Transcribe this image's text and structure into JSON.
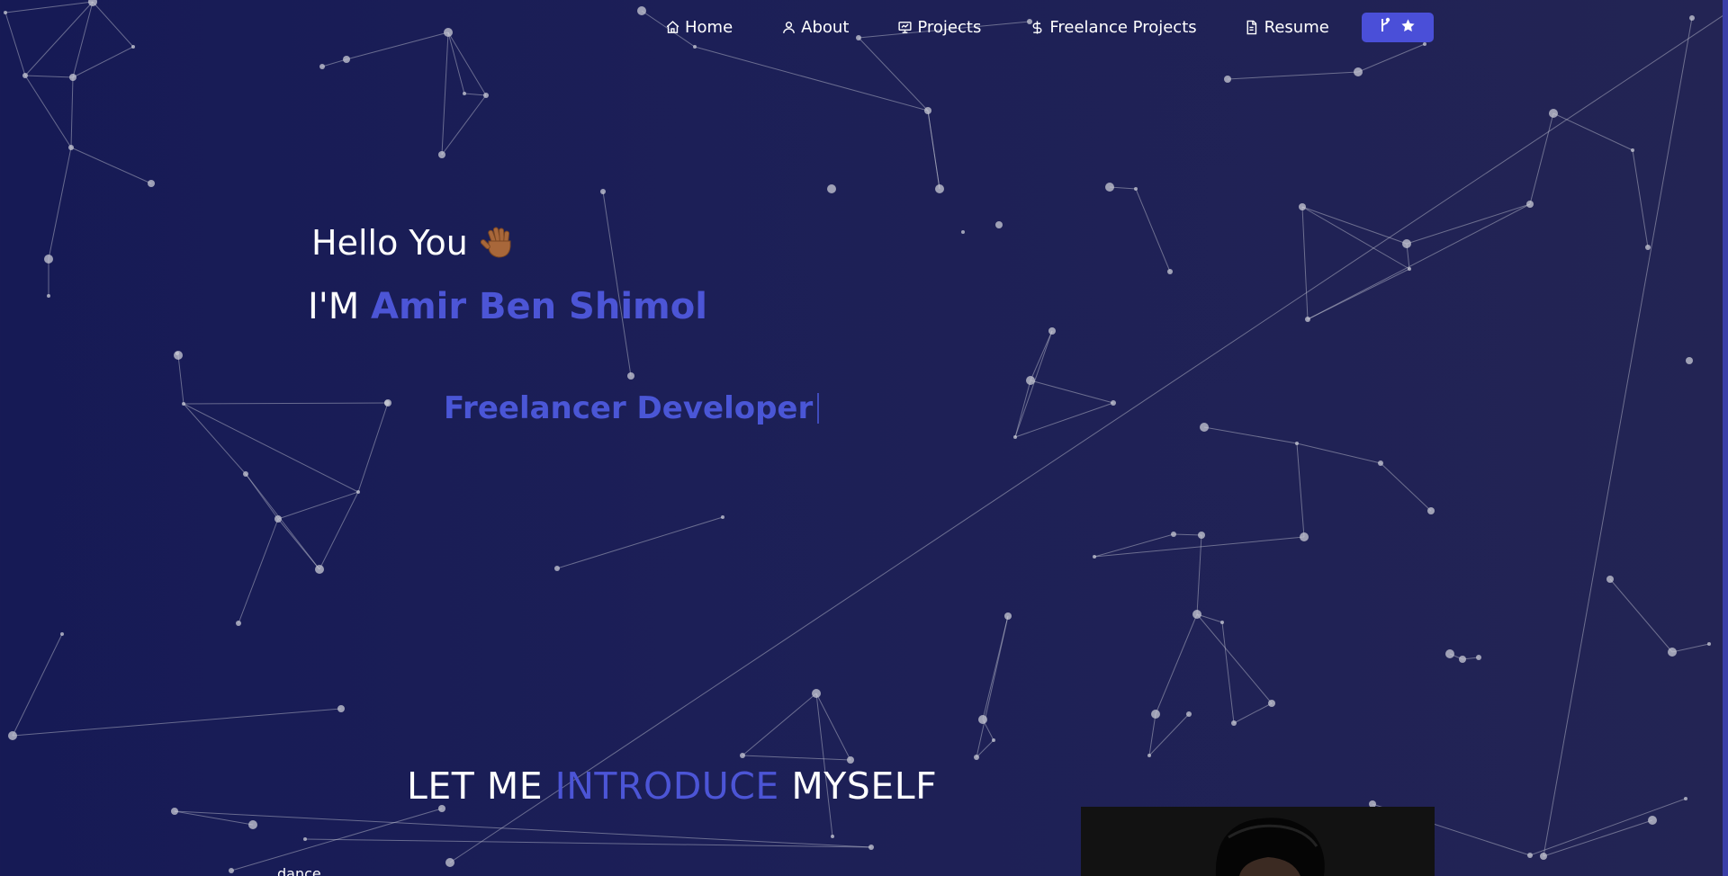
{
  "nav": {
    "items": [
      {
        "label": "Home",
        "icon": "home-icon"
      },
      {
        "label": "About",
        "icon": "user-icon"
      },
      {
        "label": "Projects",
        "icon": "presentation-icon"
      },
      {
        "label": "Freelance Projects",
        "icon": "dollar-icon"
      },
      {
        "label": "Resume",
        "icon": "document-icon"
      }
    ],
    "github_button": {
      "icons": [
        "git-fork-icon",
        "star-icon"
      ]
    }
  },
  "hero": {
    "greeting": "Hello You",
    "greeting_icon": "waving-hand-icon",
    "name_prefix": "I'M",
    "name": "Amir Ben Shimol",
    "role": "Freelancer Developer"
  },
  "intro": {
    "heading_part1": "LET ME",
    "heading_accent": "INTRODUCE",
    "heading_part2": "MYSELF",
    "cut_text": "dance"
  },
  "colors": {
    "background": "#1c1f57",
    "accent": "#4c55d6",
    "text": "#ffffff",
    "particle": "#c9cbd6"
  }
}
